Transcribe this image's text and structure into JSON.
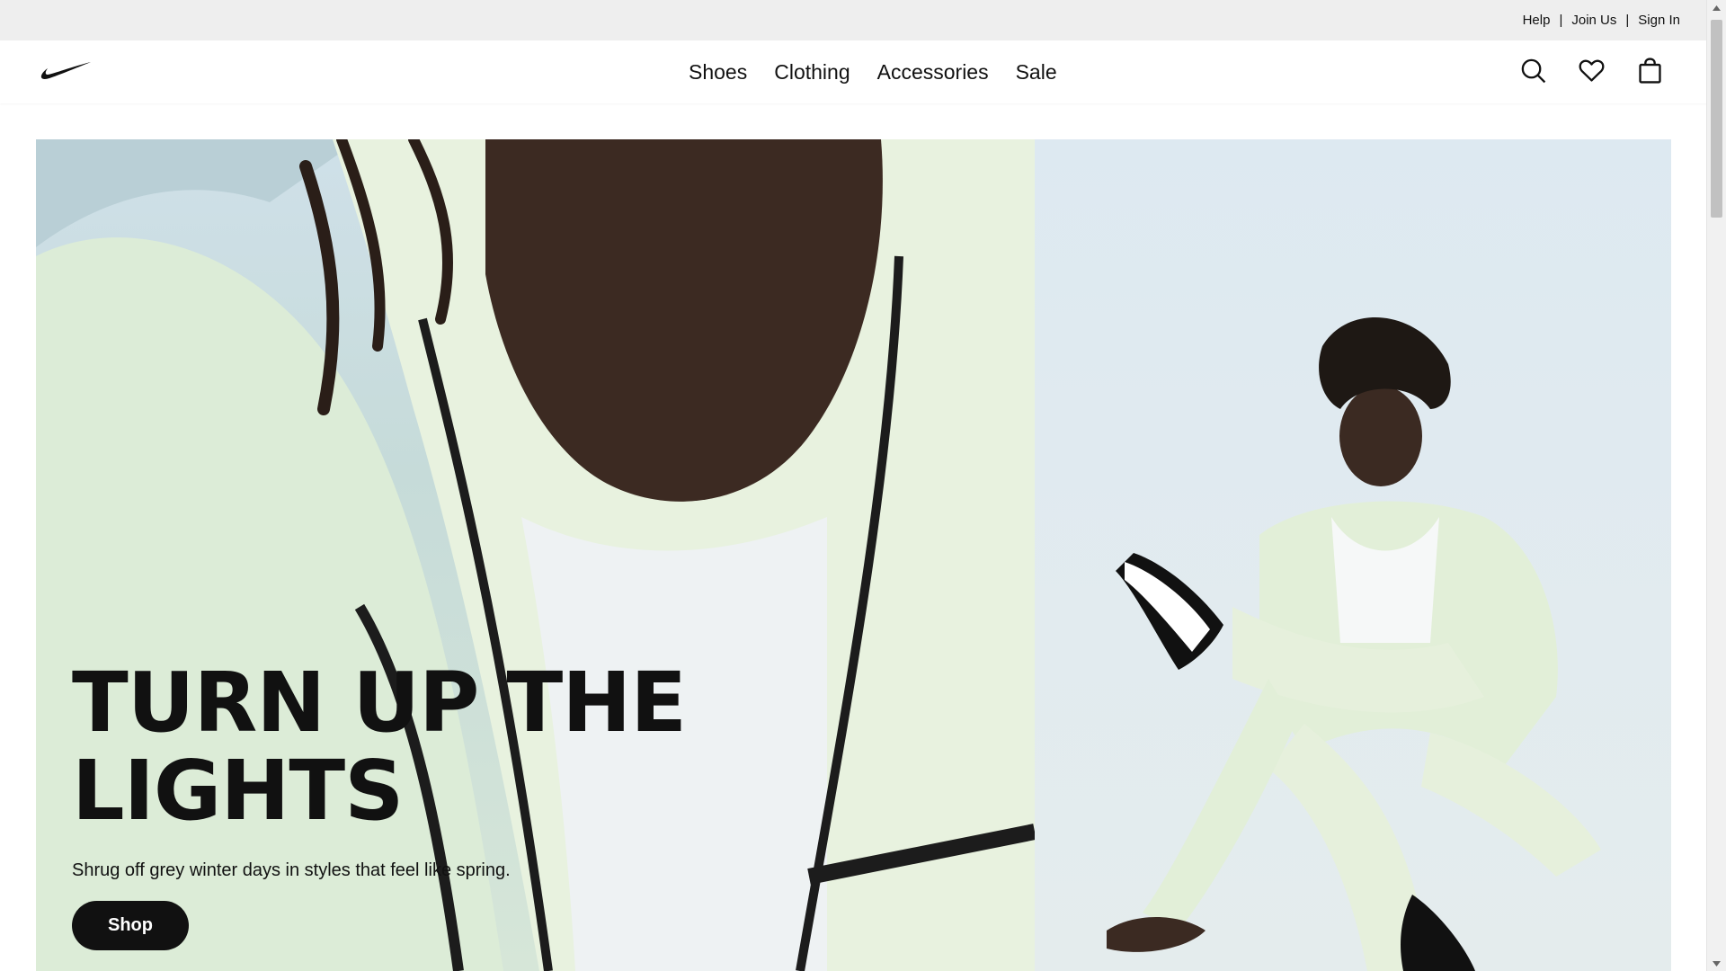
{
  "utility_bar": {
    "help": "Help",
    "join_us": "Join Us",
    "sign_in": "Sign In",
    "separator": "|"
  },
  "nav": {
    "logo_icon": "swoosh-icon",
    "links": [
      "Shoes",
      "Clothing",
      "Accessories",
      "Sale"
    ],
    "icons": [
      "search-icon",
      "heart-icon",
      "bag-icon"
    ]
  },
  "hero": {
    "headline": "TURN UP THE LIGHTS",
    "subtext": "Shrug off grey winter days in styles that feel like spring.",
    "cta": "Shop",
    "background_tint": "#d6e6d8"
  },
  "colors": {
    "text": "#111111",
    "utility_bg": "#eeeeee",
    "button_bg": "#111111",
    "button_text": "#ffffff"
  }
}
